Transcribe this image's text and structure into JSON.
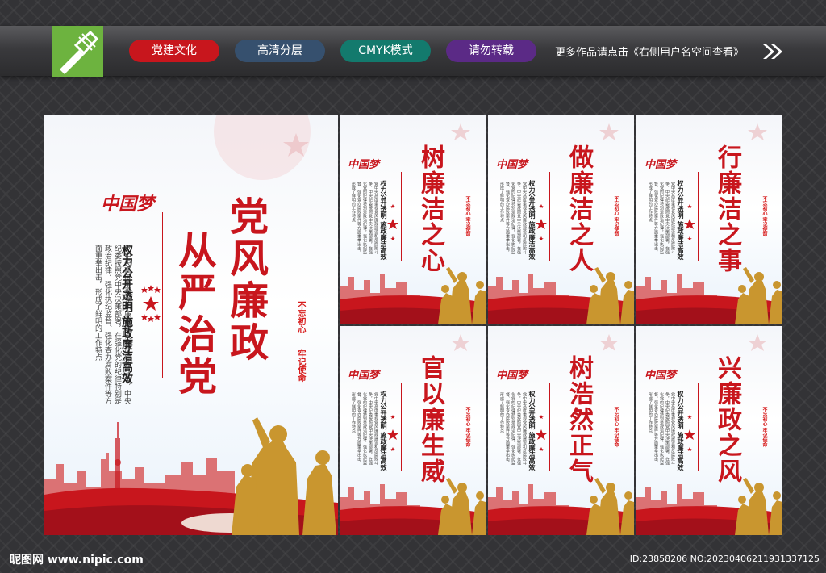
{
  "header": {
    "tags": [
      {
        "label": "党建文化",
        "color": "#c8161d"
      },
      {
        "label": "高清分层",
        "color": "#36506e"
      },
      {
        "label": "CMYK模式",
        "color": "#137a6d"
      },
      {
        "label": "请勿转载",
        "color": "#5b2a86"
      }
    ],
    "notice": "更多作品请点击《右侧用户名空间查看》"
  },
  "main_poster": {
    "title_line1": "党风廉政",
    "title_line2": "从严治党",
    "subtitle": "权力公开透明  施政廉洁高效",
    "slogan_top": "不忘初心",
    "slogan_bottom": "牢记使命",
    "brand": "中国梦",
    "body": "党中央高度重视党风廉政建设和反腐败斗争，中央纪委按照党中央决策部署，在强化党的纪律特别是政治纪律，强化执纪监督、强化查办腐败案件等方面重拳出击，形成了鲜明的工作特点"
  },
  "small_posters": [
    {
      "title": "树廉洁之心"
    },
    {
      "title": "做廉洁之人"
    },
    {
      "title": "行廉洁之事"
    },
    {
      "title": "官以廉生威"
    },
    {
      "title": "树浩然正气"
    },
    {
      "title": "兴廉政之风"
    }
  ],
  "small_common": {
    "subtitle": "权力公开透明  施政廉洁高效",
    "slogan": "不忘初心 牢记使命",
    "brand": "中国梦"
  },
  "footer": {
    "site": "昵图网 www.nipic.com",
    "id": "ID:23858206 NO:20230406211931337125"
  },
  "colors": {
    "accent_red": "#c8161d",
    "logo_green": "#6db33f"
  }
}
